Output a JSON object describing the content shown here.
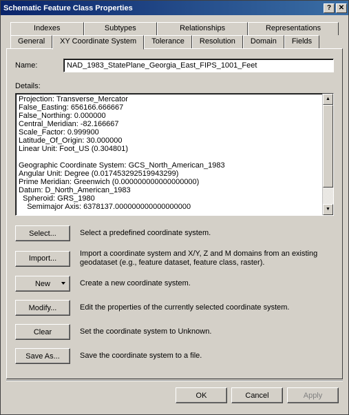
{
  "titlebar": {
    "title": "Schematic Feature Class Properties",
    "help_glyph": "?",
    "close_glyph": "✕"
  },
  "tabs": {
    "row1": [
      {
        "label": "Indexes"
      },
      {
        "label": "Subtypes"
      },
      {
        "label": "Relationships"
      },
      {
        "label": "Representations"
      }
    ],
    "row2": [
      {
        "label": "General"
      },
      {
        "label": "XY Coordinate System",
        "active": true
      },
      {
        "label": "Tolerance"
      },
      {
        "label": "Resolution"
      },
      {
        "label": "Domain"
      },
      {
        "label": "Fields"
      }
    ]
  },
  "name": {
    "label": "Name:",
    "value": "NAD_1983_StatePlane_Georgia_East_FIPS_1001_Feet"
  },
  "details": {
    "label": "Details:",
    "text": "Projection: Transverse_Mercator\nFalse_Easting: 656166.666667\nFalse_Northing: 0.000000\nCentral_Meridian: -82.166667\nScale_Factor: 0.999900\nLatitude_Of_Origin: 30.000000\nLinear Unit: Foot_US (0.304801)\n\nGeographic Coordinate System: GCS_North_American_1983\nAngular Unit: Degree (0.017453292519943299)\nPrime Meridian: Greenwich (0.000000000000000000)\nDatum: D_North_American_1983\n  Spheroid: GRS_1980\n    Semimajor Axis: 6378137.000000000000000000"
  },
  "scroll": {
    "up_glyph": "▲",
    "down_glyph": "▼"
  },
  "actions": {
    "select": {
      "label": "Select...",
      "desc": "Select a predefined coordinate system."
    },
    "import": {
      "label": "Import...",
      "desc": "Import a coordinate system and X/Y, Z and M domains from an existing geodataset (e.g., feature dataset, feature class, raster)."
    },
    "new": {
      "label": "New",
      "desc": "Create a new coordinate system."
    },
    "modify": {
      "label": "Modify...",
      "desc": "Edit the properties of the currently selected coordinate system."
    },
    "clear": {
      "label": "Clear",
      "desc": "Set the coordinate system to Unknown."
    },
    "saveas": {
      "label": "Save As...",
      "desc": "Save the coordinate system to a file."
    }
  },
  "footer": {
    "ok": "OK",
    "cancel": "Cancel",
    "apply": "Apply"
  }
}
